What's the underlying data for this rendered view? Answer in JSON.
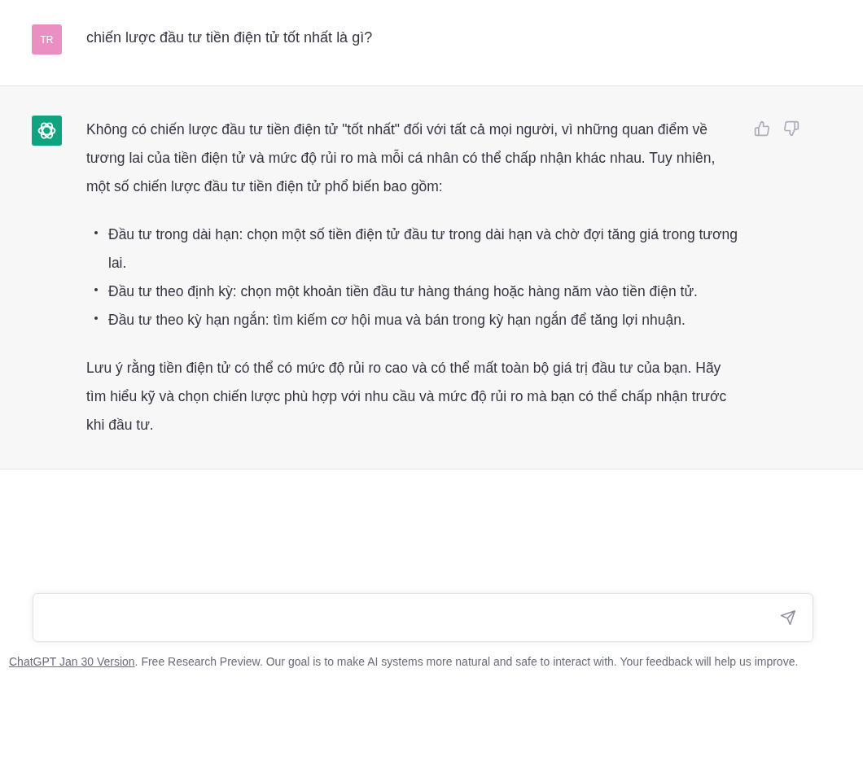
{
  "conversation": [
    {
      "kind": "user",
      "avatar": "TR",
      "text": "chiến lược đầu tư tiền điện tử tốt nhất là gì?"
    },
    {
      "kind": "assistant",
      "intro": "Không có chiến lược đầu tư tiền điện tử \"tốt nhất\" đối với tất cả mọi người, vì những quan điểm về tương lai của tiền điện tử và mức độ rủi ro mà mỗi cá nhân có thể chấp nhận khác nhau. Tuy nhiên, một số chiến lược đầu tư tiền điện tử phổ biến bao gồm:",
      "bullets": [
        "Đầu tư trong dài hạn: chọn một số tiền điện tử đầu tư trong dài hạn và chờ đợi tăng giá trong tương lai.",
        "Đầu tư theo định kỳ: chọn một khoản tiền đầu tư hàng tháng hoặc hàng năm vào tiền điện tử.",
        "Đầu tư theo kỳ hạn ngắn: tìm kiếm cơ hội mua và bán trong kỳ hạn ngắn để tăng lợi nhuận."
      ],
      "outro": "Lưu ý rằng tiền điện tử có thể có mức độ rủi ro cao và có thể mất toàn bộ giá trị đầu tư của bạn. Hãy tìm hiểu kỹ và chọn chiến lược phù hợp với nhu cầu và mức độ rủi ro mà bạn có thể chấp nhận trước khi đầu tư."
    }
  ],
  "footer": {
    "link": "ChatGPT Jan 30 Version",
    "text": ". Free Research Preview. Our goal is to make AI systems more natural and safe to interact with. Your feedback will help us improve."
  }
}
